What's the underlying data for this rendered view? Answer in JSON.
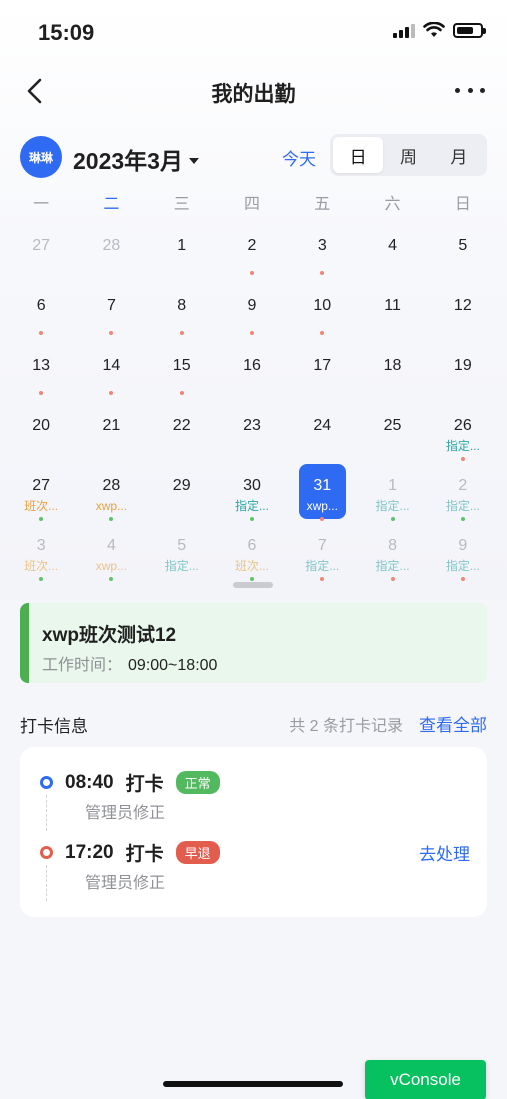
{
  "status_bar": {
    "time": "15:09"
  },
  "nav": {
    "title": "我的出勤"
  },
  "calendar_header": {
    "avatar_text": "琳琳",
    "month_title": "2023年3月",
    "today_label": "今天",
    "view_modes": [
      "日",
      "周",
      "月"
    ],
    "active_mode": "日"
  },
  "weekdays": [
    "一",
    "二",
    "三",
    "四",
    "五",
    "六",
    "日"
  ],
  "weeks": [
    [
      {
        "num": "27",
        "other": true
      },
      {
        "num": "28",
        "other": true
      },
      {
        "num": "1"
      },
      {
        "num": "2",
        "dot": "red"
      },
      {
        "num": "3",
        "dot": "red"
      },
      {
        "num": "4"
      },
      {
        "num": "5"
      }
    ],
    [
      {
        "num": "6",
        "dot": "red"
      },
      {
        "num": "7",
        "dot": "red"
      },
      {
        "num": "8",
        "dot": "red"
      },
      {
        "num": "9",
        "dot": "red"
      },
      {
        "num": "10",
        "dot": "red"
      },
      {
        "num": "11"
      },
      {
        "num": "12"
      }
    ],
    [
      {
        "num": "13",
        "dot": "red"
      },
      {
        "num": "14",
        "dot": "red"
      },
      {
        "num": "15",
        "dot": "red"
      },
      {
        "num": "16"
      },
      {
        "num": "17"
      },
      {
        "num": "18"
      },
      {
        "num": "19"
      }
    ],
    [
      {
        "num": "20"
      },
      {
        "num": "21"
      },
      {
        "num": "22"
      },
      {
        "num": "23"
      },
      {
        "num": "24"
      },
      {
        "num": "25"
      },
      {
        "num": "26",
        "label": "指定...",
        "label_color": "teal",
        "dot": "red"
      }
    ],
    [
      {
        "num": "27",
        "label": "班次...",
        "label_color": "orange",
        "dot": "green"
      },
      {
        "num": "28",
        "label": "xwp...",
        "label_color": "orange",
        "dot": "green"
      },
      {
        "num": "29"
      },
      {
        "num": "30",
        "label": "指定...",
        "label_color": "teal",
        "dot": "green"
      },
      {
        "num": "31",
        "label": "xwp...",
        "label_color": "orange",
        "dot": "red",
        "selected": true
      },
      {
        "num": "1",
        "label": "指定...",
        "label_color": "teal",
        "dot": "green",
        "other": true
      },
      {
        "num": "2",
        "label": "指定...",
        "label_color": "teal",
        "dot": "green",
        "other": true
      }
    ],
    [
      {
        "num": "3",
        "label": "班次...",
        "label_color": "orange",
        "dot": "green",
        "other": true
      },
      {
        "num": "4",
        "label": "xwp...",
        "label_color": "orange",
        "dot": "green",
        "other": true
      },
      {
        "num": "5",
        "label": "指定...",
        "label_color": "teal",
        "other": true
      },
      {
        "num": "6",
        "label": "班次...",
        "label_color": "orange",
        "dot": "green",
        "other": true
      },
      {
        "num": "7",
        "label": "指定...",
        "label_color": "teal",
        "dot": "red",
        "other": true
      },
      {
        "num": "8",
        "label": "指定...",
        "label_color": "teal",
        "dot": "red",
        "other": true
      },
      {
        "num": "9",
        "label": "指定...",
        "label_color": "teal",
        "dot": "red",
        "other": true
      }
    ]
  ],
  "shift": {
    "name": "xwp班次测试12",
    "time_label": "工作时间：",
    "time_value": "09:00~18:00"
  },
  "punch": {
    "title": "打卡信息",
    "count_text": "共 2 条打卡记录",
    "view_all": "查看全部",
    "records": [
      {
        "time": "08:40",
        "type": "打卡",
        "status": "正常",
        "note": "管理员修正",
        "marker": "blue",
        "badge": "green",
        "action": ""
      },
      {
        "time": "17:20",
        "type": "打卡",
        "status": "早退",
        "note": "管理员修正",
        "marker": "red",
        "badge": "red",
        "action": "去处理"
      }
    ]
  },
  "vconsole": {
    "label": "vConsole"
  },
  "colors": {
    "accent": "#2f6bf2",
    "success": "#53b95f",
    "danger": "#e35d4f",
    "shift_bg": "#e9f7ec",
    "vconsole": "#07c160"
  },
  "icons": {
    "back": "chevron-left-icon",
    "more": "more-dots-icon",
    "caret": "caret-down-icon"
  }
}
